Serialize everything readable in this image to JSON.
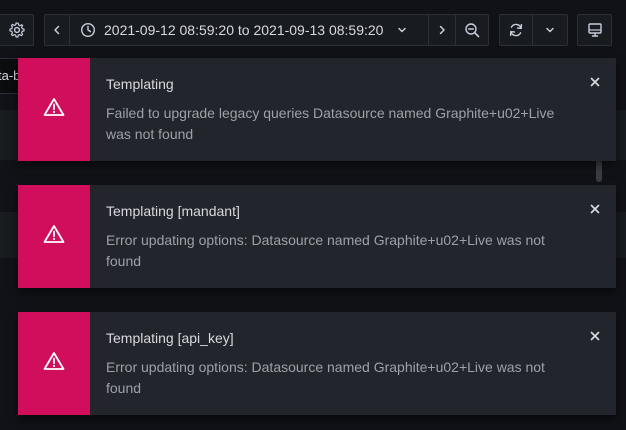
{
  "toolbar": {
    "settings_icon": "gear-icon",
    "time_back_icon": "chevron-left-icon",
    "time_range_icon": "clock-icon",
    "time_range_label": "2021-09-12 08:59:20 to 2021-09-13 08:59:20",
    "time_range_caret": "chevron-down-icon",
    "time_forward_icon": "chevron-right-icon",
    "zoom_out_icon": "zoom-out-icon",
    "refresh_icon": "sync-icon",
    "refresh_interval_caret": "chevron-down-icon",
    "tv_mode_icon": "monitor-icon"
  },
  "background": {
    "variable_input_value": "ta-b"
  },
  "alerts": [
    {
      "title": "Templating",
      "text": "Failed to upgrade legacy queries Datasource named Graphite+u02+Live was not found",
      "icon": "exclamation-triangle-icon",
      "close_icon": "close-icon"
    },
    {
      "title": "Templating [mandant]",
      "text": "Error updating options: Datasource named Graphite+u02+Live was not found",
      "icon": "exclamation-triangle-icon",
      "close_icon": "close-icon"
    },
    {
      "title": "Templating [api_key]",
      "text": "Error updating options: Datasource named Graphite+u02+Live was not found",
      "icon": "exclamation-triangle-icon",
      "close_icon": "close-icon"
    }
  ],
  "colors": {
    "page_background": "#111217",
    "alert_error_accent": "#d10e5c",
    "alert_background": "#22252b",
    "button_background": "#181b1f",
    "button_border": "#2c3036"
  }
}
